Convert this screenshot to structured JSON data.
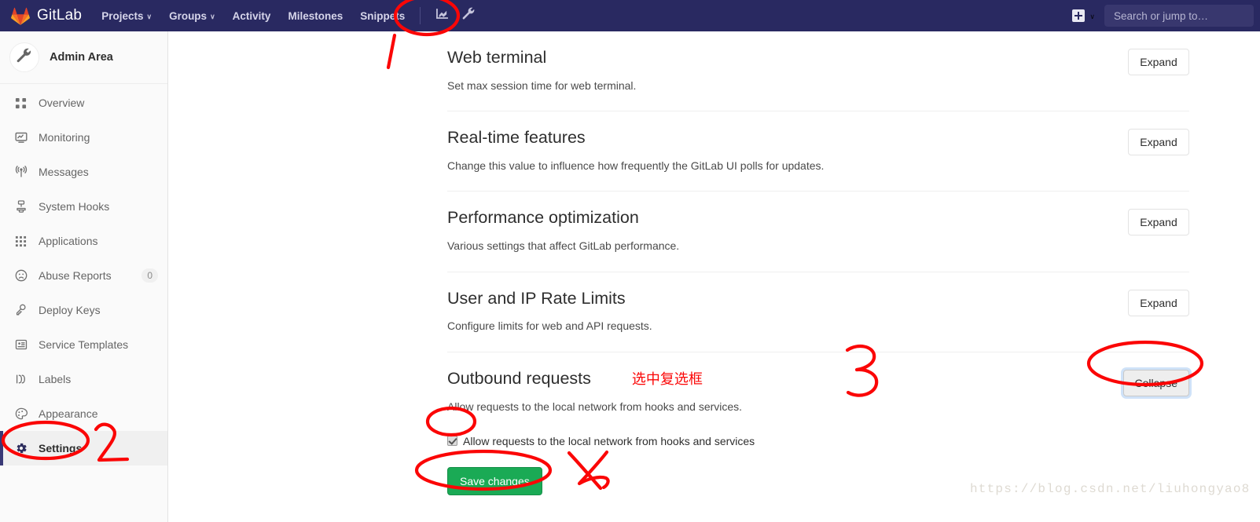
{
  "navbar": {
    "brand": "GitLab",
    "brand_icon": "gitlab-fox-logo",
    "links": [
      {
        "label": "Projects",
        "caret": "∨"
      },
      {
        "label": "Groups",
        "caret": "∨"
      },
      {
        "label": "Activity",
        "caret": ""
      },
      {
        "label": "Milestones",
        "caret": ""
      },
      {
        "label": "Snippets",
        "caret": ""
      }
    ],
    "chart_icon": "chart-icon",
    "admin_icon": "wrench-icon",
    "plus_icon": "plus-square-icon",
    "plus_caret": "∨",
    "search_placeholder": "Search or jump to…"
  },
  "sidebar": {
    "title": "Admin Area",
    "avatar_icon": "wrench-icon",
    "items": [
      {
        "label": "Overview",
        "icon": "overview-grid-icon",
        "badge": "",
        "active": false
      },
      {
        "label": "Monitoring",
        "icon": "monitor-icon",
        "badge": "",
        "active": false
      },
      {
        "label": "Messages",
        "icon": "broadcast-icon",
        "badge": "",
        "active": false
      },
      {
        "label": "System Hooks",
        "icon": "hook-icon",
        "badge": "",
        "active": false
      },
      {
        "label": "Applications",
        "icon": "applications-grid-icon",
        "badge": "",
        "active": false
      },
      {
        "label": "Abuse Reports",
        "icon": "frown-face-icon",
        "badge": "0",
        "active": false
      },
      {
        "label": "Deploy Keys",
        "icon": "key-icon",
        "badge": "",
        "active": false
      },
      {
        "label": "Service Templates",
        "icon": "template-icon",
        "badge": "",
        "active": false
      },
      {
        "label": "Labels",
        "icon": "labels-icon",
        "badge": "",
        "active": false
      },
      {
        "label": "Appearance",
        "icon": "palette-icon",
        "badge": "",
        "active": false
      },
      {
        "label": "Settings",
        "icon": "gear-icon",
        "badge": "",
        "active": true
      }
    ]
  },
  "settings": {
    "sections": [
      {
        "title": "Web terminal",
        "description": "Set max session time for web terminal.",
        "action_label": "Expand",
        "focused": false
      },
      {
        "title": "Real-time features",
        "description": "Change this value to influence how frequently the GitLab UI polls for updates.",
        "action_label": "Expand",
        "focused": false
      },
      {
        "title": "Performance optimization",
        "description": "Various settings that affect GitLab performance.",
        "action_label": "Expand",
        "focused": false
      },
      {
        "title": "User and IP Rate Limits",
        "description": "Configure limits for web and API requests.",
        "action_label": "Expand",
        "focused": false
      }
    ],
    "outbound": {
      "title": "Outbound requests",
      "note": "选中复选框",
      "description": "Allow requests to the local network from hooks and services.",
      "action_label": "Collapse",
      "checkbox_label": "Allow requests to the local network from hooks and services",
      "checkbox_checked": true,
      "save_label": "Save changes"
    }
  },
  "annotations": {
    "step1": "1",
    "step2": "2",
    "step3": "3",
    "step4": "4",
    "color": "#fb0606"
  },
  "watermark": "https://blog.csdn.net/liuhongyao8"
}
